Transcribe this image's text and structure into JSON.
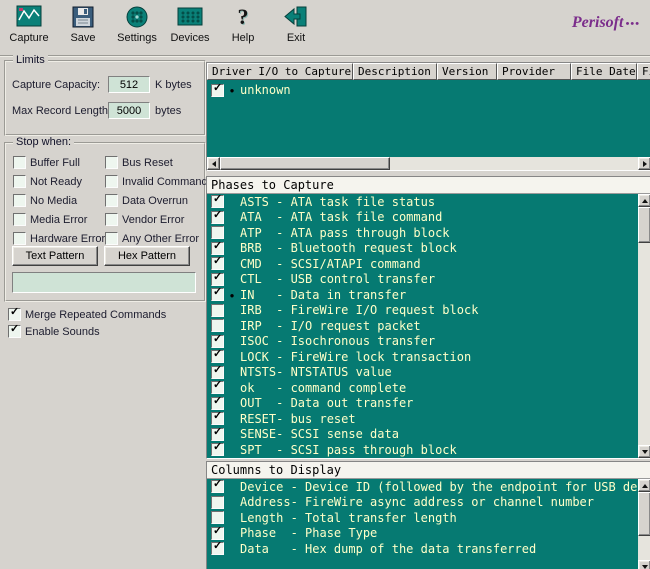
{
  "toolbar": {
    "items": [
      {
        "label": "Capture"
      },
      {
        "label": "Save"
      },
      {
        "label": "Settings"
      },
      {
        "label": "Devices"
      },
      {
        "label": "Help"
      },
      {
        "label": "Exit"
      }
    ],
    "brand": "Perisoft",
    "brand_dots": "•••"
  },
  "limits": {
    "title": "Limits",
    "capture_capacity_label": "Capture Capacity:",
    "capture_capacity_value": "512",
    "capture_capacity_unit": "K bytes",
    "max_record_label": "Max Record Length",
    "max_record_value": "5000",
    "max_record_unit": "bytes"
  },
  "stop_when": {
    "title": "Stop when:",
    "checkboxes": [
      {
        "label": "Buffer Full",
        "checked": false
      },
      {
        "label": "Bus Reset",
        "checked": false
      },
      {
        "label": "Not Ready",
        "checked": false
      },
      {
        "label": "Invalid Command",
        "checked": false
      },
      {
        "label": "No Media",
        "checked": false
      },
      {
        "label": "Data Overrun",
        "checked": false
      },
      {
        "label": "Media Error",
        "checked": false
      },
      {
        "label": "Vendor Error",
        "checked": false
      },
      {
        "label": "Hardware Error",
        "checked": false
      },
      {
        "label": "Any Other Error",
        "checked": false
      }
    ],
    "text_pattern_button": "Text Pattern",
    "hex_pattern_button": "Hex Pattern",
    "pattern_value": ""
  },
  "options": [
    {
      "label": "Merge Repeated Commands",
      "checked": true
    },
    {
      "label": "Enable Sounds",
      "checked": true
    }
  ],
  "driver_table": {
    "columns": [
      "Driver I/O to Capture",
      "Description",
      "Version",
      "Provider",
      "File Date",
      "Fi"
    ],
    "rows": [
      {
        "name": "unknown",
        "checked": true,
        "bullet": true
      }
    ]
  },
  "phases": {
    "title": "Phases to Capture",
    "items": [
      {
        "label": "ASTS - ATA task file status",
        "checked": true,
        "bullet": false
      },
      {
        "label": "ATA  - ATA task file command",
        "checked": true,
        "bullet": false
      },
      {
        "label": "ATP  - ATA pass through block",
        "checked": false,
        "bullet": false
      },
      {
        "label": "BRB  - Bluetooth request block",
        "checked": true,
        "bullet": false
      },
      {
        "label": "CMD  - SCSI/ATAPI command",
        "checked": true,
        "bullet": false
      },
      {
        "label": "CTL  - USB control transfer",
        "checked": true,
        "bullet": false
      },
      {
        "label": "IN   - Data in transfer",
        "checked": true,
        "bullet": true
      },
      {
        "label": "IRB  - FireWire I/O request block",
        "checked": false,
        "bullet": false
      },
      {
        "label": "IRP  - I/O request packet",
        "checked": false,
        "bullet": false
      },
      {
        "label": "ISOC - Isochronous transfer",
        "checked": true,
        "bullet": false
      },
      {
        "label": "LOCK - FireWire lock transaction",
        "checked": true,
        "bullet": false
      },
      {
        "label": "NTSTS- NTSTATUS value",
        "checked": true,
        "bullet": false
      },
      {
        "label": "ok   - command complete",
        "checked": true,
        "bullet": false
      },
      {
        "label": "OUT  - Data out transfer",
        "checked": true,
        "bullet": false
      },
      {
        "label": "RESET- bus reset",
        "checked": true,
        "bullet": false
      },
      {
        "label": "SENSE- SCSI sense data",
        "checked": true,
        "bullet": false
      },
      {
        "label": "SPT  - SCSI pass through block",
        "checked": true,
        "bullet": false
      }
    ]
  },
  "columns_display": {
    "title": "Columns to Display",
    "items": [
      {
        "label": "Device - Device ID (followed by the endpoint for USB devices)",
        "checked": true,
        "bullet": false
      },
      {
        "label": "Address- FireWire async address or channel number",
        "checked": false,
        "bullet": false
      },
      {
        "label": "Length - Total transfer length",
        "checked": false,
        "bullet": false
      },
      {
        "label": "Phase  - Phase Type",
        "checked": true,
        "bullet": false
      },
      {
        "label": "Data   - Hex dump of the data transferred",
        "checked": true,
        "bullet": false
      }
    ]
  }
}
